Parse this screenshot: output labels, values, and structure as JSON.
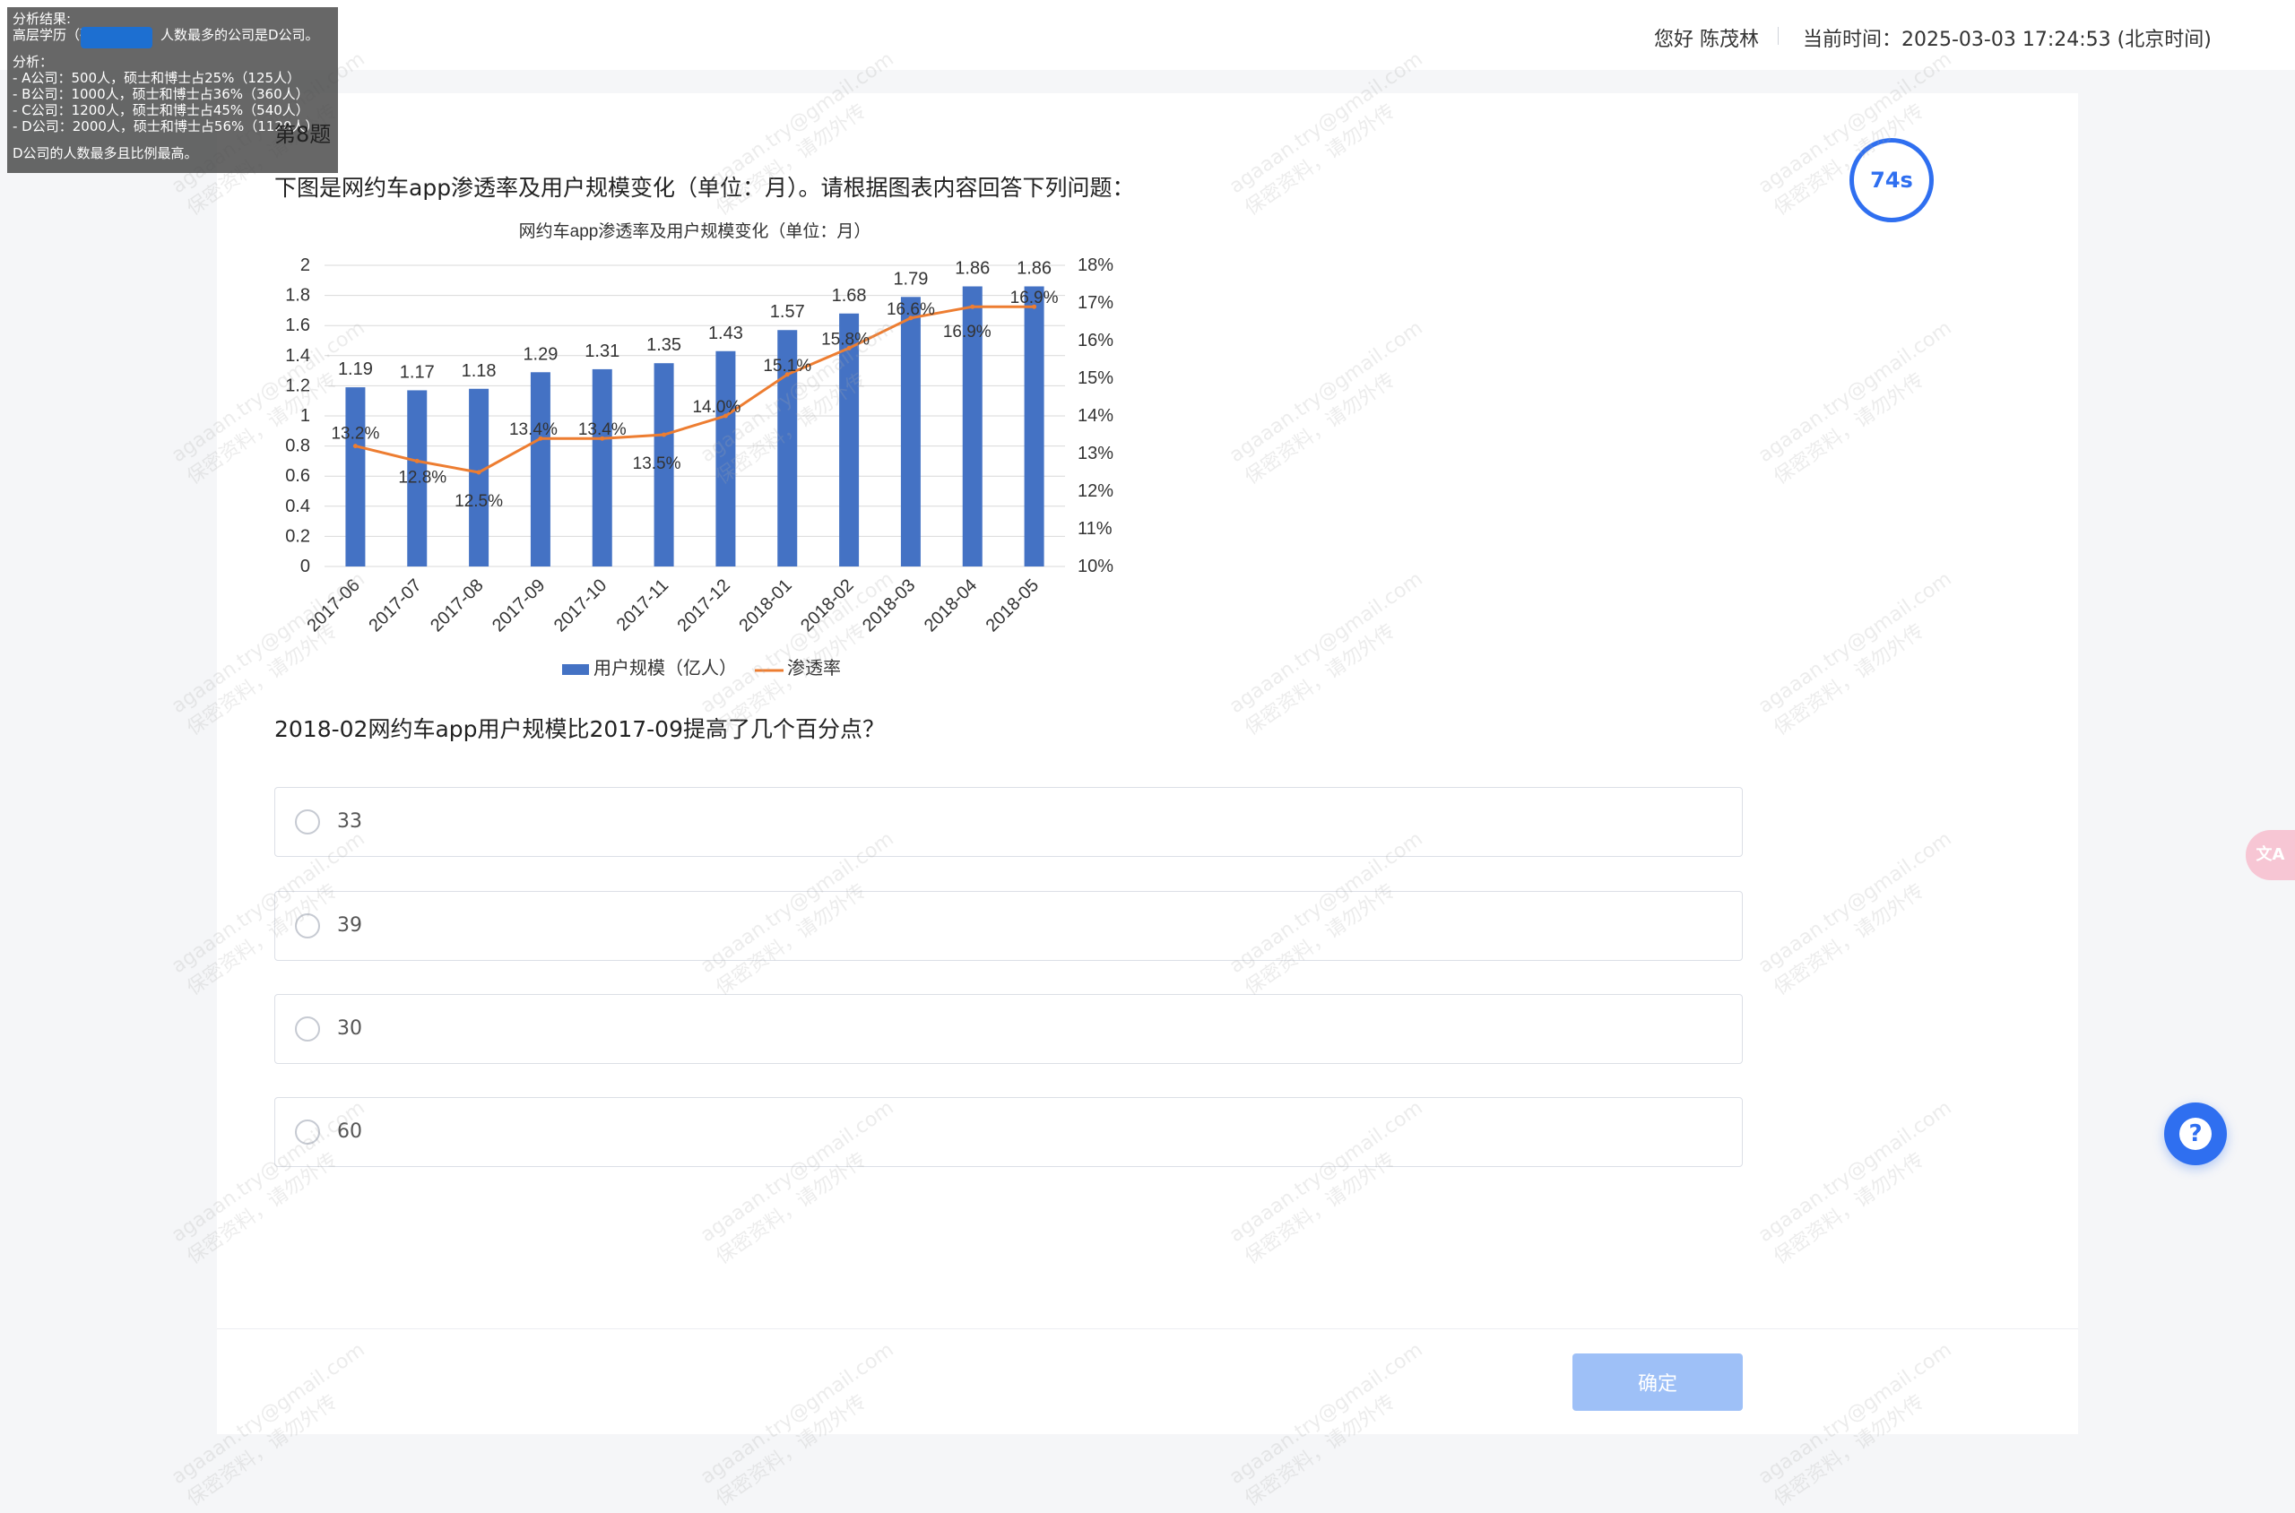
{
  "header": {
    "greeting": "您好 陈茂林",
    "time": "当前时间：2025-03-03 17:24:53 (北京时间)"
  },
  "overlay": {
    "lines": [
      "分析结果:",
      "高层学历（硕士、博士）人数最多的公司是D公司。",
      "",
      "分析：",
      "- A公司：500人，硕士和博士占25%（125人）",
      "- B公司：1000人，硕士和博士占36%（360人）",
      "- C公司：1200人，硕士和博士占45%（540人）",
      "- D公司：2000人，硕士和博士占56%（1120人）",
      "",
      "D公司的人数最多且比例最高。"
    ]
  },
  "question": {
    "number": "第8题",
    "intro": "下图是网约车app渗透率及用户规模变化（单位：月）。请根据图表内容回答下列问题：",
    "text": "2018-02网约车app用户规模比2017-09提高了几个百分点？",
    "options": [
      {
        "label": "33"
      },
      {
        "label": "39"
      },
      {
        "label": "30"
      },
      {
        "label": "60"
      }
    ]
  },
  "timer": "74s",
  "confirm_label": "确定",
  "icons": {
    "help": "help-icon",
    "translate": "translate-icon"
  },
  "translate_glyph": "文A",
  "help_glyph": "?",
  "watermark": {
    "line1": "agaaan.try@gmail.com",
    "line2": "保密资料，请勿外传"
  },
  "colors": {
    "bar": "#4472c4",
    "line": "#ed7d31",
    "accent": "#2f6ff0",
    "confirm": "#9ec0f7"
  },
  "chart_data": {
    "type": "bar",
    "title": "网约车app渗透率及用户规模变化（单位：月）",
    "categories": [
      "2017-06",
      "2017-07",
      "2017-08",
      "2017-09",
      "2017-10",
      "2017-11",
      "2017-12",
      "2018-01",
      "2018-02",
      "2018-03",
      "2018-04",
      "2018-05"
    ],
    "series": [
      {
        "name": "用户规模（亿人）",
        "type": "bar",
        "axis": "left",
        "values": [
          1.19,
          1.17,
          1.18,
          1.29,
          1.31,
          1.35,
          1.43,
          1.57,
          1.68,
          1.79,
          1.86,
          1.86
        ],
        "labels": [
          "1.19",
          "1.17",
          "1.18",
          "1.29",
          "1.31",
          "1.35",
          "1.43",
          "1.57",
          "1.68",
          "1.79",
          "1.86",
          "1.86"
        ]
      },
      {
        "name": "渗透率",
        "type": "line",
        "axis": "right",
        "values": [
          13.2,
          12.8,
          12.5,
          13.4,
          13.4,
          13.5,
          14.0,
          15.1,
          15.8,
          16.6,
          16.9,
          16.9
        ],
        "labels": [
          "13.2%",
          "12.8%",
          "12.5%",
          "13.4%",
          "13.4%",
          "13.5%",
          "14.0%",
          "15.1%",
          "15.8%",
          "16.6%",
          "16.9%",
          "16.9%"
        ]
      }
    ],
    "ylim_left": [
      0,
      2
    ],
    "yticks_left": [
      "0",
      "0.2",
      "0.4",
      "0.6",
      "0.8",
      "1",
      "1.2",
      "1.4",
      "1.6",
      "1.8",
      "2"
    ],
    "ylim_right": [
      10,
      18
    ],
    "yticks_right": [
      "10%",
      "11%",
      "12%",
      "13%",
      "14%",
      "15%",
      "16%",
      "17%",
      "18%"
    ],
    "grid": true,
    "legend": "bottom"
  }
}
